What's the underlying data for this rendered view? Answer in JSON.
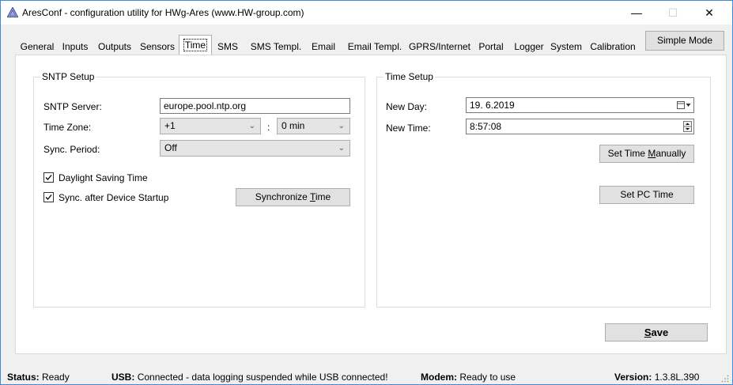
{
  "window": {
    "title": "AresConf - configuration utility for HWg-Ares (www.HW-group.com)",
    "minimize": "—",
    "maximize": "☐",
    "close": "✕"
  },
  "tabs": [
    {
      "label": "General"
    },
    {
      "label": "Inputs"
    },
    {
      "label": "Outputs"
    },
    {
      "label": "Sensors"
    },
    {
      "label": "Time",
      "active": true
    },
    {
      "label": "SMS"
    },
    {
      "label": "SMS Templ."
    },
    {
      "label": "Email"
    },
    {
      "label": "Email Templ."
    },
    {
      "label": "GPRS/Internet"
    },
    {
      "label": "Portal"
    },
    {
      "label": "Logger"
    },
    {
      "label": "System"
    },
    {
      "label": "Calibration"
    }
  ],
  "simple_mode_label": "Simple Mode",
  "sntp": {
    "group_title": "SNTP Setup",
    "server_label": "SNTP Server:",
    "server_value": "europe.pool.ntp.org",
    "timezone_label": "Time Zone:",
    "timezone_hours": "+1",
    "timezone_sep": ":",
    "timezone_minutes": "0 min",
    "sync_period_label": "Sync. Period:",
    "sync_period_value": "Off",
    "dst_label": "Daylight Saving Time",
    "dst_checked": true,
    "sync_startup_label": "Sync. after Device Startup",
    "sync_startup_checked": true,
    "synchronize_button_pre": "Synchronize ",
    "synchronize_button_key": "T",
    "synchronize_button_post": "ime"
  },
  "time_setup": {
    "group_title": "Time Setup",
    "new_day_label": "New Day:",
    "new_day_value": "19.  6.2019",
    "new_time_label": "New Time:",
    "new_time_value": "8:57:08",
    "set_manually_pre": "Set Time ",
    "set_manually_key": "M",
    "set_manually_post": "anually",
    "set_pc_time_label": "Set PC Time"
  },
  "save_button_key": "S",
  "save_button_post": "ave",
  "status": {
    "status_label": "Status:",
    "status_value": "Ready",
    "usb_label": "USB:",
    "usb_value": "Connected - data logging suspended while USB connected!",
    "modem_label": "Modem:",
    "modem_value": "Ready to use",
    "version_label": "Version:",
    "version_value": "1.3.8L.390"
  },
  "colors": {
    "window_border": "#3c8ad8",
    "background": "#f0f0f0",
    "button_face": "#e1e1e1"
  }
}
